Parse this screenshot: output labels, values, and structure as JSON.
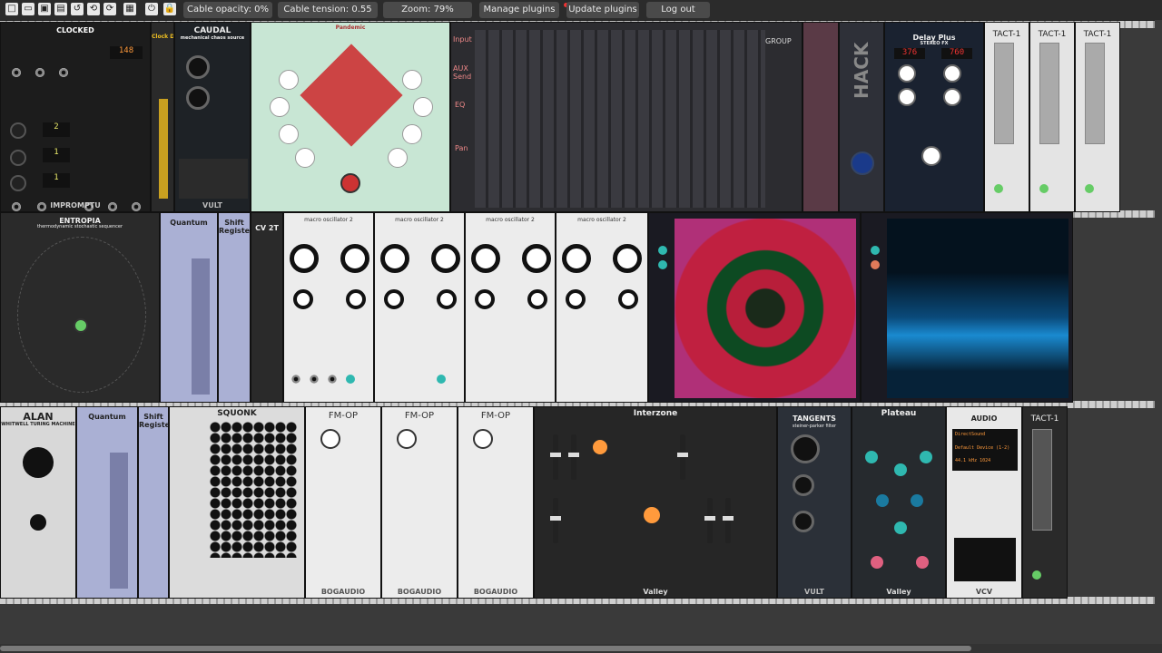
{
  "toolbar": {
    "icons": [
      "new-icon",
      "open-icon",
      "save-icon",
      "save-as-icon",
      "revert-icon",
      "undo-icon",
      "redo-icon",
      "power-icon",
      "lock-icon"
    ],
    "cable_opacity": "Cable opacity: 0%",
    "cable_tension": "Cable tension: 0.55",
    "zoom": "Zoom: 79%",
    "manage_plugins": "Manage plugins",
    "update_plugins": "Update plugins",
    "log_out": "Log out"
  },
  "modules": {
    "clocked": {
      "title": "CLOCKED",
      "bpm": "148",
      "ratio1": "2",
      "ratio2": "1",
      "ratio3": "1",
      "footer": "IMPROMPTU"
    },
    "clock_divider": {
      "title": "Clock Divider"
    },
    "caudal": {
      "title": "CAUDAL",
      "subtitle": "mechanical chaos source",
      "footer": "VULT"
    },
    "rosette": {
      "title": "Pandemic"
    },
    "mixer": {
      "title": "GROUP",
      "labels": [
        "Input",
        "AUX Send",
        "EQ",
        "Pan"
      ]
    },
    "hack": {
      "title": "HACK"
    },
    "delay": {
      "title": "Delay Plus",
      "subtitle": "STEREO FX",
      "left": "376",
      "right": "760"
    },
    "tact1": {
      "title": "TACT-1"
    },
    "tact2": {
      "title": "TACT-1"
    },
    "tact3": {
      "title": "TACT-1"
    },
    "entropia": {
      "title": "ENTROPIA",
      "subtitle": "thermodynamic stochastic sequencer"
    },
    "quantum1": {
      "title": "Quantum"
    },
    "shift1": {
      "title": "Shift Register"
    },
    "cv2t": {
      "title": "CV 2T"
    },
    "macro1": {
      "title": "macro oscillator 2"
    },
    "macro2": {
      "title": "macro oscillator 2"
    },
    "macro3": {
      "title": "macro oscillator 2"
    },
    "macro4": {
      "title": "macro oscillator 2"
    },
    "alan": {
      "title": "ALAN",
      "subtitle": "WHITWELL TURING MACHINE"
    },
    "quantum2": {
      "title": "Quantum"
    },
    "shift2": {
      "title": "Shift Register"
    },
    "squonk": {
      "title": "SQUONK"
    },
    "fmop1": {
      "title": "FM-OP",
      "footer": "BOGAUDIO"
    },
    "fmop2": {
      "title": "FM-OP",
      "footer": "BOGAUDIO"
    },
    "fmop3": {
      "title": "FM-OP",
      "footer": "BOGAUDIO"
    },
    "interzone": {
      "title": "Interzone",
      "footer": "Valley"
    },
    "tangents": {
      "title": "TANGENTS",
      "subtitle": "steiner-parker filter",
      "footer": "VULT"
    },
    "plateau": {
      "title": "Plateau",
      "footer": "Valley"
    },
    "audio": {
      "title": "AUDIO",
      "line1": "DirectSound",
      "line2": "Default Device (1-2)",
      "line3": "44.1 kHz  1024",
      "footer": "VCV"
    },
    "tact4": {
      "title": "TACT-1"
    }
  },
  "colors": {
    "accent_orange": "#ff9a3c",
    "teal": "#2fb8b0",
    "red": "#d42a2a"
  }
}
